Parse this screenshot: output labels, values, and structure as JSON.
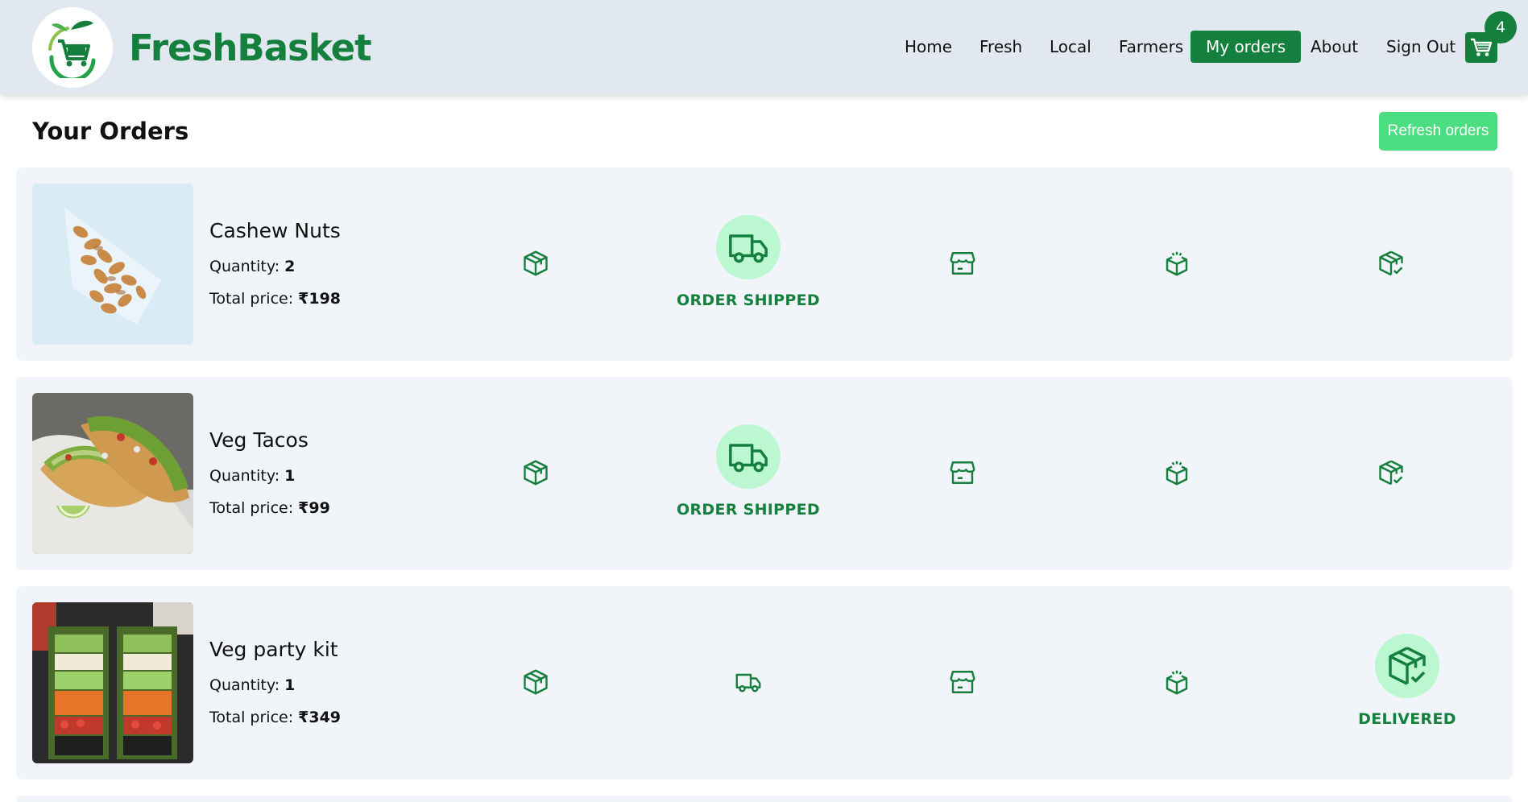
{
  "brand": {
    "name": "FreshBasket"
  },
  "nav": {
    "items": [
      {
        "label": "Home"
      },
      {
        "label": "Fresh"
      },
      {
        "label": "Local"
      },
      {
        "label": "Farmers"
      },
      {
        "label": "My orders"
      },
      {
        "label": "About"
      },
      {
        "label": "Sign Out"
      }
    ],
    "active_index": 4,
    "cart_count": "4"
  },
  "page": {
    "title": "Your Orders",
    "refresh_label": "Refresh orders"
  },
  "labels": {
    "quantity": "Quantity: ",
    "total_price": "Total price: "
  },
  "steps": [
    {
      "icon": "package-icon"
    },
    {
      "icon": "truck-icon"
    },
    {
      "icon": "store-icon"
    },
    {
      "icon": "box-open-icon"
    },
    {
      "icon": "box-check-icon"
    }
  ],
  "orders": [
    {
      "name": "Cashew Nuts",
      "quantity": "2",
      "price": "₹198",
      "image": "cashew-nuts-image",
      "status_step": 1,
      "status_label": "ORDER SHIPPED"
    },
    {
      "name": "Veg Tacos",
      "quantity": "1",
      "price": "₹99",
      "image": "veg-tacos-image",
      "status_step": 1,
      "status_label": "ORDER SHIPPED"
    },
    {
      "name": "Veg party kit",
      "quantity": "1",
      "price": "₹349",
      "image": "veg-party-kit-image",
      "status_step": 4,
      "status_label": "DELIVERED"
    }
  ],
  "colors": {
    "brand": "#15803d",
    "header_bg": "#e2e8f0",
    "card_bg": "#f1f5f9",
    "accent_light": "#bbf7d0",
    "refresh_bg": "#4ade80"
  }
}
